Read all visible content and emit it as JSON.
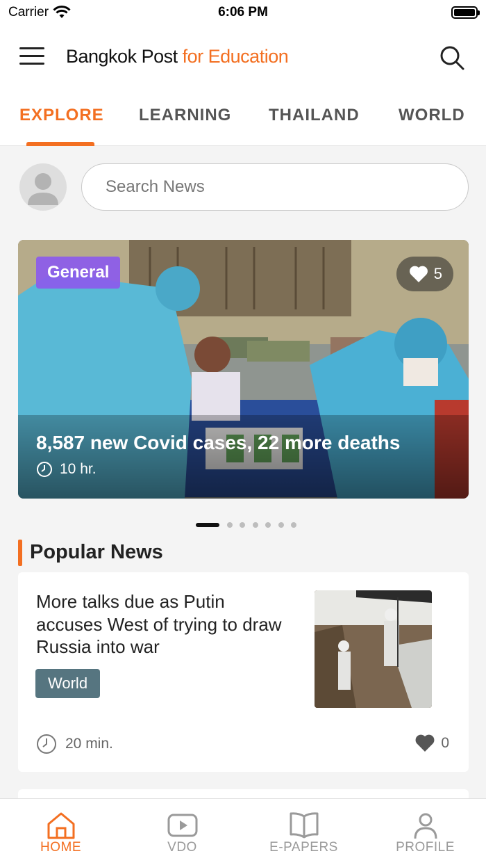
{
  "status_bar": {
    "carrier": "Carrier",
    "time": "6:06 PM"
  },
  "header": {
    "brand_main": "Bangkok Post",
    "brand_accent": "for Education"
  },
  "tabs": [
    {
      "label": "EXPLORE",
      "active": true
    },
    {
      "label": "LEARNING",
      "active": false
    },
    {
      "label": "THAILAND",
      "active": false
    },
    {
      "label": "WORLD",
      "active": false
    }
  ],
  "search": {
    "placeholder": "Search News"
  },
  "featured": {
    "category": "General",
    "likes": "5",
    "title": "8,587 new Covid cases, 22 more deaths",
    "time": "10 hr."
  },
  "carousel": {
    "slide_count": 7,
    "active_index": 0
  },
  "popular": {
    "heading": "Popular News",
    "items": [
      {
        "title": "More talks due as Putin accuses West of trying to draw Russia into war",
        "tag": "World",
        "time": "20 min.",
        "likes": "0"
      }
    ]
  },
  "bottom_nav": [
    {
      "label": "HOME",
      "icon": "home-icon",
      "active": true
    },
    {
      "label": "VDO",
      "icon": "video-icon",
      "active": false
    },
    {
      "label": "E-PAPERS",
      "icon": "book-icon",
      "active": false
    },
    {
      "label": "PROFILE",
      "icon": "person-icon",
      "active": false
    }
  ],
  "colors": {
    "accent": "#f36f21",
    "badge_purple": "#8c5aeb",
    "tag_slate": "#567580",
    "text": "#222222"
  }
}
